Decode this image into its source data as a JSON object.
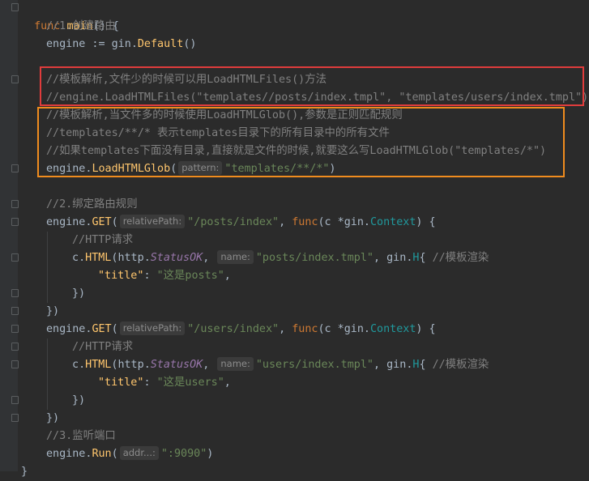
{
  "colors": {
    "background": "#2b2b2b",
    "keyword": "#cc7832",
    "function": "#ffc66d",
    "comment": "#808080",
    "string": "#6a8759",
    "highlight_red": "#e03c3c",
    "highlight_orange": "#f08c1e"
  },
  "code": {
    "l1": {
      "kw": "func",
      "name": "main",
      "rest": "() {"
    },
    "l2": {
      "comment": "//1.创建路由"
    },
    "l3": {
      "var": "engine",
      "op": " := ",
      "pkg": "gin",
      "fn": "Default",
      "rest": "()"
    },
    "l5": {
      "comment": "//模板解析,文件少的时候可以用LoadHTMLFiles()方法"
    },
    "l6": {
      "comment": "//engine.LoadHTMLFiles(\"templates//posts/index.tmpl\", \"templates/users/index.tmpl\")"
    },
    "l7": {
      "comment": "//模板解析,当文件多的时候使用LoadHTMLGlob(),参数是正则匹配规则"
    },
    "l8": {
      "comment": "//templates/**/* 表示templates目录下的所有目录中的所有文件"
    },
    "l9": {
      "comment": "//如果templates下面没有目录,直接就是文件的时候,就要这么写LoadHTMLGlob(\"templates/*\")"
    },
    "l10": {
      "var": "engine",
      "fn": "LoadHTMLGlob",
      "hint": "pattern:",
      "str": "\"templates/**/*\"",
      "rest": ")"
    },
    "l12": {
      "comment": "//2.绑定路由规则"
    },
    "l13": {
      "var": "engine",
      "fn": "GET",
      "hint": "relativePath:",
      "str": "\"/posts/index\"",
      "kw": "func",
      "param": "c *",
      "pkg": "gin",
      "type": "Context",
      "rest": ") {"
    },
    "l14": {
      "comment": "//HTTP请求"
    },
    "l15": {
      "var": "c",
      "fn": "HTML",
      "pkg": "http",
      "const": "StatusOK",
      "hint": "name:",
      "str": "\"posts/index.tmpl\"",
      "pkg2": "gin",
      "type": "H",
      "comment": "//模板渲染"
    },
    "l16": {
      "key": "\"title\"",
      "str": "\"这是posts\""
    },
    "l17": {
      "text": "})"
    },
    "l18": {
      "text": "})"
    },
    "l19": {
      "var": "engine",
      "fn": "GET",
      "hint": "relativePath:",
      "str": "\"/users/index\"",
      "kw": "func",
      "param": "c *",
      "pkg": "gin",
      "type": "Context",
      "rest": ") {"
    },
    "l20": {
      "comment": "//HTTP请求"
    },
    "l21": {
      "var": "c",
      "fn": "HTML",
      "pkg": "http",
      "const": "StatusOK",
      "hint": "name:",
      "str": "\"users/index.tmpl\"",
      "pkg2": "gin",
      "type": "H",
      "comment": "//模板渲染"
    },
    "l22": {
      "key": "\"title\"",
      "str": "\"这是users\""
    },
    "l23": {
      "text": "})"
    },
    "l24": {
      "text": "})"
    },
    "l25": {
      "comment": "//3.监听端口"
    },
    "l26": {
      "var": "engine",
      "fn": "Run",
      "hint": "addr...:",
      "str": "\":9090\"",
      "rest": ")"
    },
    "l27": {
      "text": "}"
    }
  }
}
